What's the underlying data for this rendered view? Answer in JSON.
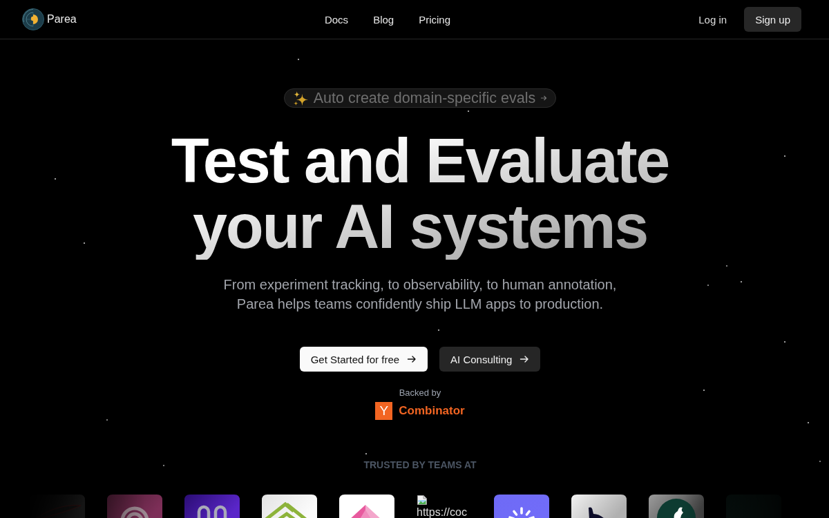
{
  "nav": {
    "brand": "Parea",
    "links": [
      "Docs",
      "Blog",
      "Pricing"
    ],
    "login": "Log in",
    "signup": "Sign up"
  },
  "hero": {
    "announcement": "Auto create domain-specific evals",
    "title": "Test and Evaluate your AI systems",
    "subtitle": "From experiment tracking, to observability, to human annotation, Parea helps teams confidently ship LLM apps to production.",
    "buttons": [
      {
        "label": "Get Started for free",
        "kind": "primary"
      },
      {
        "label": "AI Consulting",
        "kind": "secondary"
      }
    ],
    "backed_by": "Backed by",
    "backer": {
      "mark": "Y",
      "name": "Combinator"
    }
  },
  "trusted": {
    "heading": "TRUSTED BY TEAMS AT",
    "logo_image_alt": "https://coc"
  }
}
